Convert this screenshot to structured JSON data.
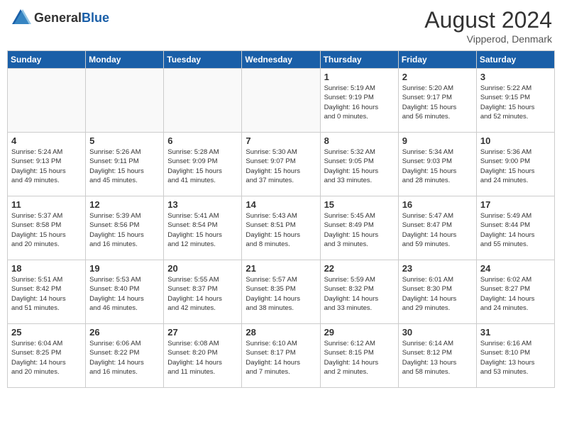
{
  "header": {
    "logo_general": "General",
    "logo_blue": "Blue",
    "month_year": "August 2024",
    "location": "Vipperod, Denmark"
  },
  "weekdays": [
    "Sunday",
    "Monday",
    "Tuesday",
    "Wednesday",
    "Thursday",
    "Friday",
    "Saturday"
  ],
  "weeks": [
    [
      {
        "day": "",
        "info": ""
      },
      {
        "day": "",
        "info": ""
      },
      {
        "day": "",
        "info": ""
      },
      {
        "day": "",
        "info": ""
      },
      {
        "day": "1",
        "info": "Sunrise: 5:19 AM\nSunset: 9:19 PM\nDaylight: 16 hours\nand 0 minutes."
      },
      {
        "day": "2",
        "info": "Sunrise: 5:20 AM\nSunset: 9:17 PM\nDaylight: 15 hours\nand 56 minutes."
      },
      {
        "day": "3",
        "info": "Sunrise: 5:22 AM\nSunset: 9:15 PM\nDaylight: 15 hours\nand 52 minutes."
      }
    ],
    [
      {
        "day": "4",
        "info": "Sunrise: 5:24 AM\nSunset: 9:13 PM\nDaylight: 15 hours\nand 49 minutes."
      },
      {
        "day": "5",
        "info": "Sunrise: 5:26 AM\nSunset: 9:11 PM\nDaylight: 15 hours\nand 45 minutes."
      },
      {
        "day": "6",
        "info": "Sunrise: 5:28 AM\nSunset: 9:09 PM\nDaylight: 15 hours\nand 41 minutes."
      },
      {
        "day": "7",
        "info": "Sunrise: 5:30 AM\nSunset: 9:07 PM\nDaylight: 15 hours\nand 37 minutes."
      },
      {
        "day": "8",
        "info": "Sunrise: 5:32 AM\nSunset: 9:05 PM\nDaylight: 15 hours\nand 33 minutes."
      },
      {
        "day": "9",
        "info": "Sunrise: 5:34 AM\nSunset: 9:03 PM\nDaylight: 15 hours\nand 28 minutes."
      },
      {
        "day": "10",
        "info": "Sunrise: 5:36 AM\nSunset: 9:00 PM\nDaylight: 15 hours\nand 24 minutes."
      }
    ],
    [
      {
        "day": "11",
        "info": "Sunrise: 5:37 AM\nSunset: 8:58 PM\nDaylight: 15 hours\nand 20 minutes."
      },
      {
        "day": "12",
        "info": "Sunrise: 5:39 AM\nSunset: 8:56 PM\nDaylight: 15 hours\nand 16 minutes."
      },
      {
        "day": "13",
        "info": "Sunrise: 5:41 AM\nSunset: 8:54 PM\nDaylight: 15 hours\nand 12 minutes."
      },
      {
        "day": "14",
        "info": "Sunrise: 5:43 AM\nSunset: 8:51 PM\nDaylight: 15 hours\nand 8 minutes."
      },
      {
        "day": "15",
        "info": "Sunrise: 5:45 AM\nSunset: 8:49 PM\nDaylight: 15 hours\nand 3 minutes."
      },
      {
        "day": "16",
        "info": "Sunrise: 5:47 AM\nSunset: 8:47 PM\nDaylight: 14 hours\nand 59 minutes."
      },
      {
        "day": "17",
        "info": "Sunrise: 5:49 AM\nSunset: 8:44 PM\nDaylight: 14 hours\nand 55 minutes."
      }
    ],
    [
      {
        "day": "18",
        "info": "Sunrise: 5:51 AM\nSunset: 8:42 PM\nDaylight: 14 hours\nand 51 minutes."
      },
      {
        "day": "19",
        "info": "Sunrise: 5:53 AM\nSunset: 8:40 PM\nDaylight: 14 hours\nand 46 minutes."
      },
      {
        "day": "20",
        "info": "Sunrise: 5:55 AM\nSunset: 8:37 PM\nDaylight: 14 hours\nand 42 minutes."
      },
      {
        "day": "21",
        "info": "Sunrise: 5:57 AM\nSunset: 8:35 PM\nDaylight: 14 hours\nand 38 minutes."
      },
      {
        "day": "22",
        "info": "Sunrise: 5:59 AM\nSunset: 8:32 PM\nDaylight: 14 hours\nand 33 minutes."
      },
      {
        "day": "23",
        "info": "Sunrise: 6:01 AM\nSunset: 8:30 PM\nDaylight: 14 hours\nand 29 minutes."
      },
      {
        "day": "24",
        "info": "Sunrise: 6:02 AM\nSunset: 8:27 PM\nDaylight: 14 hours\nand 24 minutes."
      }
    ],
    [
      {
        "day": "25",
        "info": "Sunrise: 6:04 AM\nSunset: 8:25 PM\nDaylight: 14 hours\nand 20 minutes."
      },
      {
        "day": "26",
        "info": "Sunrise: 6:06 AM\nSunset: 8:22 PM\nDaylight: 14 hours\nand 16 minutes."
      },
      {
        "day": "27",
        "info": "Sunrise: 6:08 AM\nSunset: 8:20 PM\nDaylight: 14 hours\nand 11 minutes."
      },
      {
        "day": "28",
        "info": "Sunrise: 6:10 AM\nSunset: 8:17 PM\nDaylight: 14 hours\nand 7 minutes."
      },
      {
        "day": "29",
        "info": "Sunrise: 6:12 AM\nSunset: 8:15 PM\nDaylight: 14 hours\nand 2 minutes."
      },
      {
        "day": "30",
        "info": "Sunrise: 6:14 AM\nSunset: 8:12 PM\nDaylight: 13 hours\nand 58 minutes."
      },
      {
        "day": "31",
        "info": "Sunrise: 6:16 AM\nSunset: 8:10 PM\nDaylight: 13 hours\nand 53 minutes."
      }
    ]
  ]
}
